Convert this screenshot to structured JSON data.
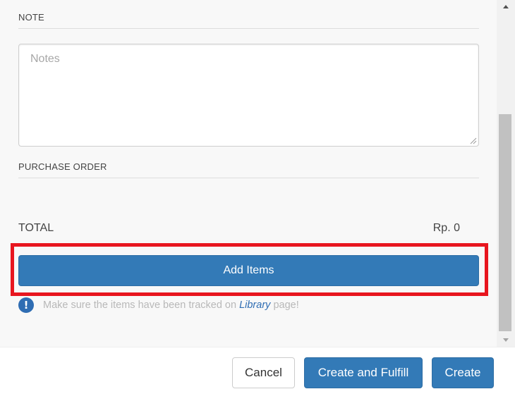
{
  "form": {
    "note_label": "NOTE",
    "notes_placeholder": "Notes",
    "notes_value": "",
    "purchase_order_label": "PURCHASE ORDER",
    "total_label": "TOTAL",
    "total_value": "Rp. 0",
    "add_items_label": "Add Items",
    "info_icon_glyph": "!",
    "info_before": "Make sure the items have been tracked on",
    "info_link": "Library",
    "info_after": "page!"
  },
  "footer": {
    "cancel_label": "Cancel",
    "create_fulfill_label": "Create and Fulfill",
    "create_label": "Create"
  },
  "icons": {
    "info": "exclamation-circle-icon",
    "scroll_up": "triangle-up-icon",
    "scroll_down": "triangle-down-icon",
    "resize": "resize-grip-icon"
  },
  "colors": {
    "primary": "#337ab7",
    "highlight": "#e8161f",
    "info_icon": "#2f6db3",
    "muted_text": "#b8b8b8"
  }
}
